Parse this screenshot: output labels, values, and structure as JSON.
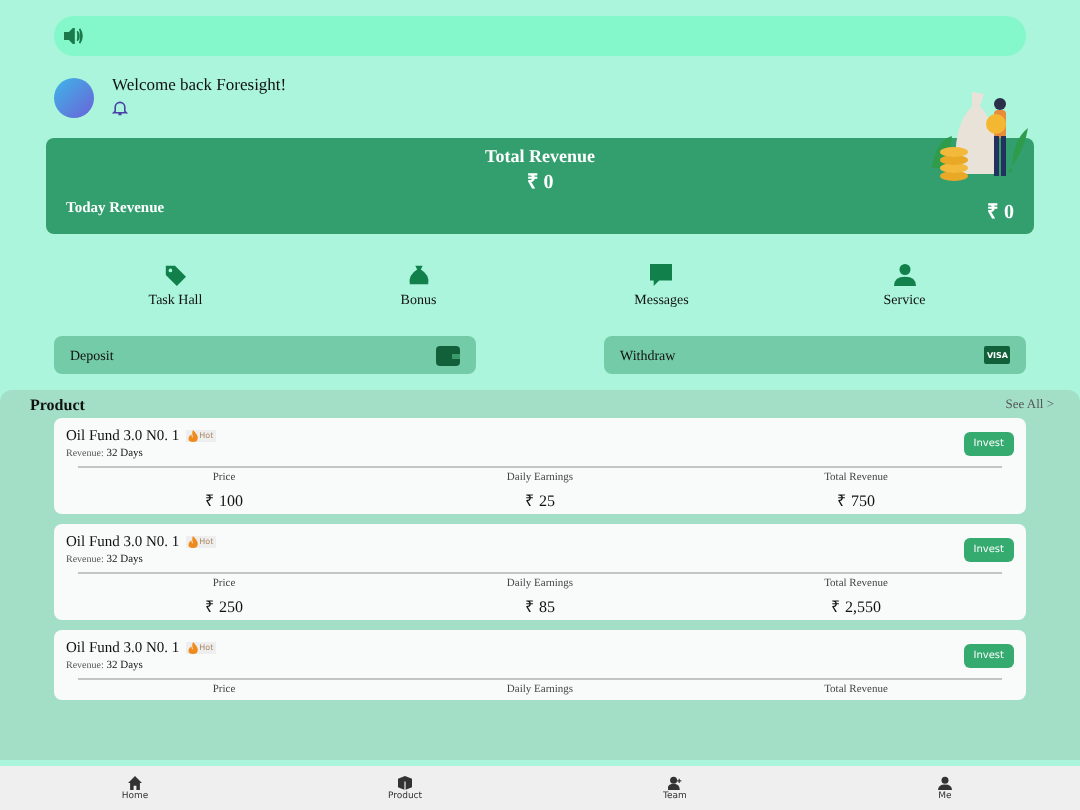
{
  "welcome": {
    "text": "Welcome back Foresight!"
  },
  "revenue_card": {
    "title": "Total Revenue",
    "total": "₹ 0",
    "today_label": "Today Revenue",
    "today_value": "₹ 0"
  },
  "shortcuts": [
    {
      "kind": "tag",
      "label": "Task Hall"
    },
    {
      "kind": "bag",
      "label": "Bonus"
    },
    {
      "kind": "chat",
      "label": "Messages"
    },
    {
      "kind": "person",
      "label": "Service"
    }
  ],
  "actions": [
    {
      "kind": "wallet",
      "label": "Deposit"
    },
    {
      "kind": "card",
      "label": "Withdraw",
      "icon_text": "VISA"
    }
  ],
  "product": {
    "title": "Product",
    "see_all": "See All >",
    "items": [
      {
        "name": "Oil Fund 3.0 N0. 1",
        "badge": "Hot",
        "revenue_label": "Revenue:",
        "revenue_value": "32 Days",
        "button": "Invest",
        "stats": [
          {
            "label": "Price",
            "value": "₹ 100"
          },
          {
            "label": "Daily Earnings",
            "value": "₹ 25"
          },
          {
            "label": "Total Revenue",
            "value": "₹ 750"
          }
        ]
      },
      {
        "name": "Oil Fund 3.0 N0. 1",
        "badge": "Hot",
        "revenue_label": "Revenue:",
        "revenue_value": "32 Days",
        "button": "Invest",
        "stats": [
          {
            "label": "Price",
            "value": "₹ 250"
          },
          {
            "label": "Daily Earnings",
            "value": "₹ 85"
          },
          {
            "label": "Total Revenue",
            "value": "₹ 2,550"
          }
        ]
      },
      {
        "name": "Oil Fund 3.0 N0. 1",
        "badge": "Hot",
        "revenue_label": "Revenue:",
        "revenue_value": "32 Days",
        "button": "Invest",
        "stats": [
          {
            "label": "Price"
          },
          {
            "label": "Daily Earnings"
          },
          {
            "label": "Total Revenue"
          }
        ]
      }
    ]
  },
  "bottom_nav": [
    {
      "kind": "home",
      "label": "Home"
    },
    {
      "kind": "box",
      "label": "Product"
    },
    {
      "kind": "team",
      "label": "Team"
    },
    {
      "kind": "me",
      "label": "Me"
    }
  ]
}
